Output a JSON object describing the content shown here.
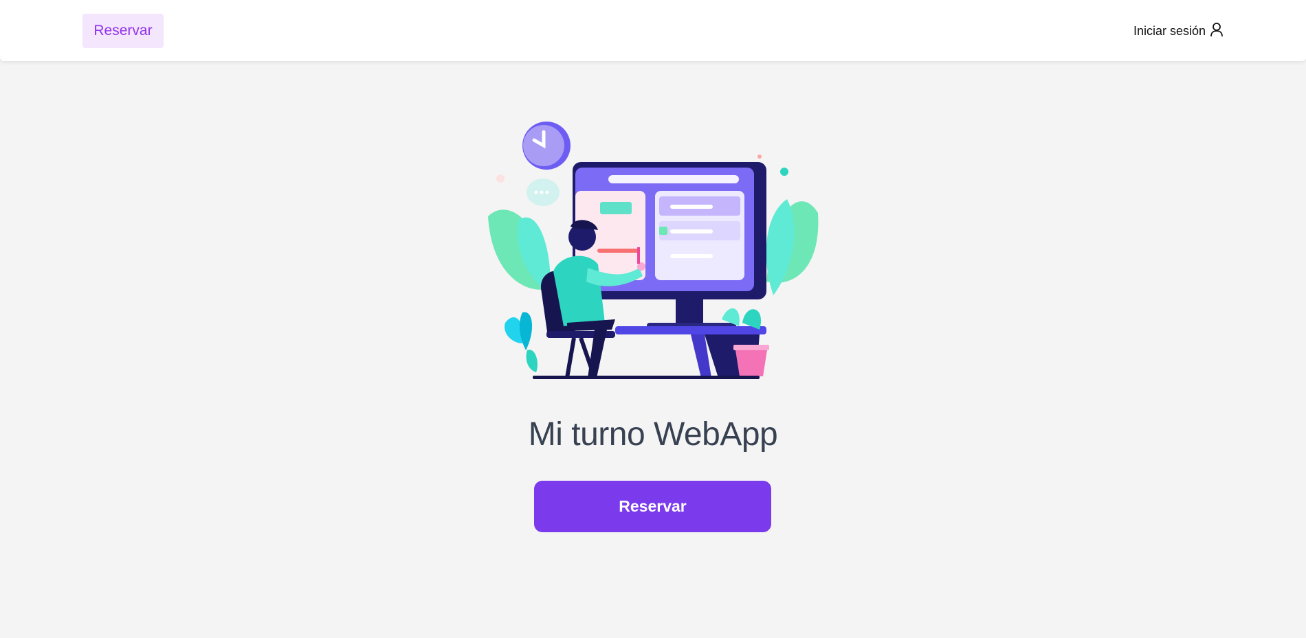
{
  "header": {
    "reserve_label": "Reservar",
    "login_label": "Iniciar sesión",
    "login_icon": "user-icon"
  },
  "hero": {
    "illustration": "person-at-computer-illustration",
    "title": "Mi turno WebApp",
    "cta_label": "Reservar"
  },
  "colors": {
    "accent": "#7c3aed",
    "accent_light": "#f3e6fd",
    "accent_text": "#9333ea",
    "title_text": "#374151",
    "background": "#f4f4f4"
  }
}
